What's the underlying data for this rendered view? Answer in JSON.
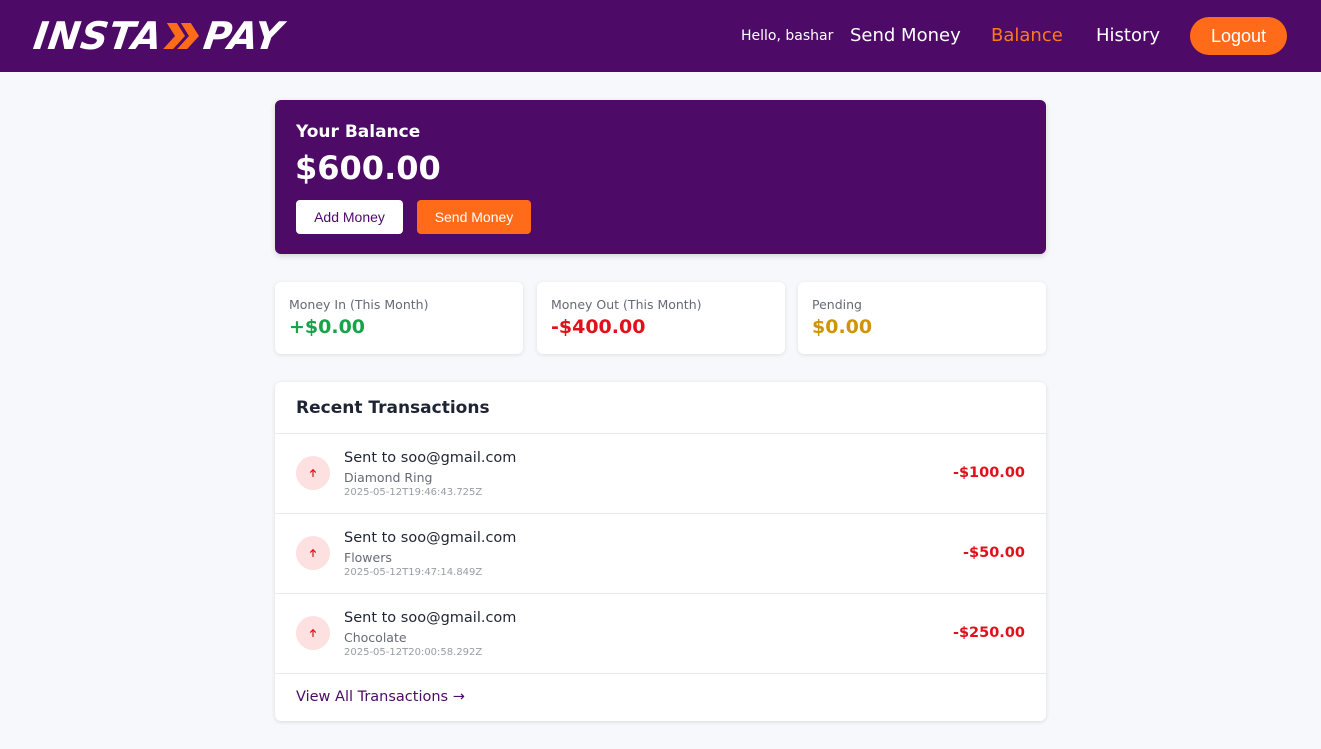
{
  "header": {
    "logo": {
      "part1": "INSTA",
      "part2": "PAY",
      "icon": "double-chevron-icon",
      "accent": "#ff6b18"
    },
    "greeting": "Hello, bashar",
    "nav": {
      "send_money": "Send Money",
      "balance": "Balance",
      "history": "History"
    },
    "active_nav": "Balance",
    "logout": "Logout"
  },
  "balance_card": {
    "label": "Your Balance",
    "amount": "$600.00",
    "add_money": "Add Money",
    "send_money": "Send Money"
  },
  "stats": [
    {
      "label": "Money In (This Month)",
      "value": "+$0.00",
      "color": "#17a34a"
    },
    {
      "label": "Money Out (This Month)",
      "value": "-$400.00",
      "color": "#e0111b"
    },
    {
      "label": "Pending",
      "value": "$0.00",
      "color": "#d19408"
    }
  ],
  "transactions": {
    "title": "Recent Transactions",
    "items": [
      {
        "name": "Sent to soo@gmail.com",
        "note": "Diamond Ring",
        "timestamp": "2025-05-12T19:46:43.725Z",
        "amount": "-$100.00",
        "icon": "arrow-up-icon"
      },
      {
        "name": "Sent to soo@gmail.com",
        "note": "Flowers",
        "timestamp": "2025-05-12T19:47:14.849Z",
        "amount": "-$50.00",
        "icon": "arrow-up-icon"
      },
      {
        "name": "Sent to soo@gmail.com",
        "note": "Chocolate",
        "timestamp": "2025-05-12T20:00:58.292Z",
        "amount": "-$250.00",
        "icon": "arrow-up-icon"
      }
    ],
    "view_all": "View All Transactions →"
  },
  "colors": {
    "brand_purple": "#4d0a67",
    "accent_orange": "#ff6b18",
    "nav_active": "#ff7a1a"
  }
}
